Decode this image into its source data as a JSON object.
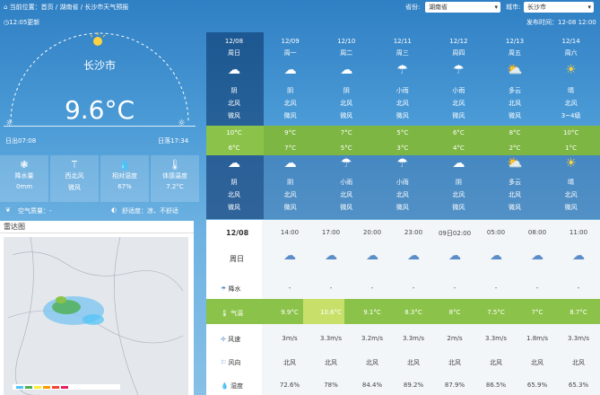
{
  "header": {
    "breadcrumb": "当前位置：首页 / 湖南省 / 长沙市天气预报",
    "province_label": "省份:",
    "province_value": "湖南省",
    "city_label": "城市:",
    "city_value": "长沙市",
    "updated": "12:05更新",
    "publish": "发布时间：12-08 12:00"
  },
  "current": {
    "city": "长沙市",
    "temperature": "9.6°C",
    "sunrise": "日出07:08",
    "sunset": "日落17:34",
    "stats": [
      {
        "icon": "rain-drops-icon",
        "label": "降水量",
        "value": "0mm"
      },
      {
        "icon": "wind-icon",
        "label": "西北风",
        "value": "微风"
      },
      {
        "icon": "humidity-icon",
        "label": "相对湿度",
        "value": "67%"
      },
      {
        "icon": "thermometer-icon",
        "label": "体感温度",
        "value": "7.2°C"
      }
    ],
    "air_quality": "空气质量：-",
    "comfort": "舒适度：凉、不舒适"
  },
  "radar": {
    "title": "雷达图"
  },
  "forecast": [
    {
      "date": "12/08",
      "weekday": "周日",
      "day_icon": "cloudy-icon",
      "day_weather": "阴",
      "day_wind_dir": "北风",
      "day_wind": "微风",
      "high": "10°C",
      "low": "6°C",
      "night_icon": "cloudy-icon",
      "night_weather": "阴",
      "night_wind_dir": "北风",
      "night_wind": "微风"
    },
    {
      "date": "12/09",
      "weekday": "周一",
      "day_icon": "cloudy-icon",
      "day_weather": "阴",
      "day_wind_dir": "北风",
      "day_wind": "微风",
      "high": "9°C",
      "low": "7°C",
      "night_icon": "cloudy-icon",
      "night_weather": "阴",
      "night_wind_dir": "北风",
      "night_wind": "微风"
    },
    {
      "date": "12/10",
      "weekday": "周二",
      "day_icon": "cloudy-icon",
      "day_weather": "阴",
      "day_wind_dir": "北风",
      "day_wind": "微风",
      "high": "7°C",
      "low": "5°C",
      "night_icon": "rain-icon",
      "night_weather": "小雨",
      "night_wind_dir": "北风",
      "night_wind": "微风"
    },
    {
      "date": "12/11",
      "weekday": "周三",
      "day_icon": "rain-icon",
      "day_weather": "小雨",
      "day_wind_dir": "北风",
      "day_wind": "微风",
      "high": "5°C",
      "low": "3°C",
      "night_icon": "rain-icon",
      "night_weather": "小雨",
      "night_wind_dir": "北风",
      "night_wind": "微风"
    },
    {
      "date": "12/12",
      "weekday": "周四",
      "day_icon": "rain-icon",
      "day_weather": "小雨",
      "day_wind_dir": "北风",
      "day_wind": "微风",
      "high": "6°C",
      "low": "4°C",
      "night_icon": "cloudy-icon",
      "night_weather": "阴",
      "night_wind_dir": "北风",
      "night_wind": "微风"
    },
    {
      "date": "12/13",
      "weekday": "周五",
      "day_icon": "partly-cloudy-icon",
      "day_weather": "多云",
      "day_wind_dir": "北风",
      "day_wind": "微风",
      "high": "8°C",
      "low": "2°C",
      "night_icon": "partly-cloudy-icon",
      "night_weather": "多云",
      "night_wind_dir": "北风",
      "night_wind": "微风"
    },
    {
      "date": "12/14",
      "weekday": "周六",
      "day_icon": "sunny-icon",
      "day_weather": "晴",
      "day_wind_dir": "北风",
      "day_wind": "3~4级",
      "high": "10°C",
      "low": "1°C",
      "night_icon": "sunny-icon",
      "night_weather": "晴",
      "night_wind_dir": "北风",
      "night_wind": "微风"
    }
  ],
  "hourly": {
    "date": "12/08",
    "weekday": "周日",
    "row_labels": {
      "rain": "降水",
      "temp": "气温",
      "speed": "风速",
      "dir": "风向",
      "humidity": "湿度"
    },
    "times": [
      "14:00",
      "17:00",
      "20:00",
      "23:00",
      "09日02:00",
      "05:00",
      "08:00",
      "11:00"
    ],
    "rain": [
      "-",
      "-",
      "-",
      "-",
      "-",
      "-",
      "-",
      "-"
    ],
    "temp": [
      "9.9°C",
      "10.6°C",
      "9.1°C",
      "8.3°C",
      "8°C",
      "7.5°C",
      "7°C",
      "8.7°C"
    ],
    "speed": [
      "3m/s",
      "3.3m/s",
      "3.2m/s",
      "3.3m/s",
      "2m/s",
      "3.3m/s",
      "1.8m/s",
      "3.3m/s"
    ],
    "dir": [
      "北风",
      "北风",
      "北风",
      "北风",
      "北风",
      "北风",
      "北风",
      "北风"
    ],
    "humidity": [
      "72.6%",
      "78%",
      "84.4%",
      "89.2%",
      "87.9%",
      "86.5%",
      "65.9%",
      "65.3%"
    ]
  }
}
